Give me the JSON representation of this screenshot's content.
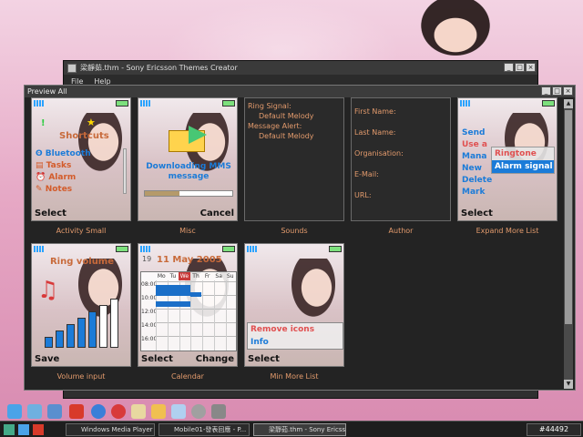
{
  "app": {
    "title": "梁靜茹.thm - Sony Ericsson Themes Creator",
    "menu": [
      "File",
      "Help"
    ]
  },
  "preview": {
    "title": "Preview All"
  },
  "screens": {
    "activity": {
      "caption": "Activity Small",
      "title": "Shortcuts",
      "items": [
        "Bluetooth",
        "Tasks",
        "Alarm",
        "Notes"
      ],
      "softkey_left": "Select"
    },
    "misc": {
      "caption": "Misc",
      "text1": "Downloading MMS",
      "text2": "message",
      "progress": 0.4,
      "softkey_right": "Cancel"
    },
    "sounds": {
      "caption": "Sounds",
      "lines": [
        "Ring Signal:",
        "Default Melody",
        "Message Alert:",
        "Default Melody"
      ]
    },
    "author": {
      "caption": "Author",
      "lines": [
        "First Name:",
        "Last Name:",
        "Organisation:",
        "E-Mail:",
        "URL:"
      ]
    },
    "expand": {
      "caption": "Expand More List",
      "items": [
        "Send",
        "Use a",
        "Mana",
        "New",
        "Delete",
        "Mark"
      ],
      "popup": [
        "Ringtone",
        "Alarm signal"
      ],
      "softkey_left": "Select"
    },
    "volume": {
      "caption": "Volume input",
      "title": "Ring volume",
      "level": 5,
      "softkey_left": "Save"
    },
    "calendar": {
      "caption": "Calendar",
      "date": "11 May 2005",
      "day": "19",
      "days": [
        "Mo",
        "Tu",
        "We",
        "Th",
        "Fr",
        "Sa",
        "Su"
      ],
      "times": [
        "08:00",
        "10:00",
        "12:00",
        "14:00",
        "16:00"
      ],
      "softkey_left": "Select",
      "softkey_right": "Change"
    },
    "minmore": {
      "caption": "Min More List",
      "items": [
        "Remove icons",
        "Info"
      ],
      "softkey_left": "Select"
    }
  },
  "taskbar": {
    "buttons": [
      "Windows Media Player",
      "Mobile01-發表回應 - P...",
      "梁靜茹.thm - Sony Ericss..."
    ],
    "tray": "#44492"
  }
}
